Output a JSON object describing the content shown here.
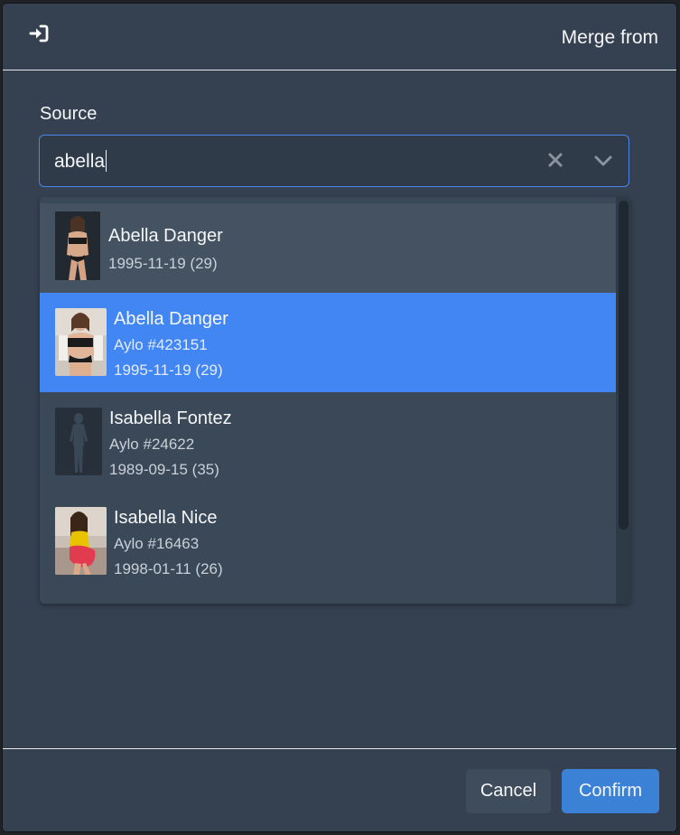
{
  "modal": {
    "title": "Merge from",
    "icon": "sign-in-icon"
  },
  "source": {
    "label": "Source",
    "value": "abella",
    "clear_icon": "clear-x-icon",
    "dropdown_icon": "chevron-down-icon"
  },
  "options": [
    {
      "name": "Abella Danger",
      "lines": [
        "1995-11-19 (29)"
      ],
      "highlighted": false
    },
    {
      "name": "Abella Danger",
      "lines": [
        "Aylo #423151",
        "1995-11-19 (29)"
      ],
      "highlighted": true
    },
    {
      "name": "Isabella Fontez",
      "lines": [
        "Aylo #24622",
        "1989-09-15 (35)"
      ],
      "highlighted": false
    },
    {
      "name": "Isabella Nice",
      "lines": [
        "Aylo #16463",
        "1998-01-11 (26)"
      ],
      "highlighted": false
    }
  ],
  "footer": {
    "cancel_label": "Cancel",
    "confirm_label": "Confirm"
  },
  "colors": {
    "modal_bg": "#354150",
    "highlight": "#4286f4",
    "confirm": "#3b82d6",
    "focus_border": "#4a86e8"
  }
}
